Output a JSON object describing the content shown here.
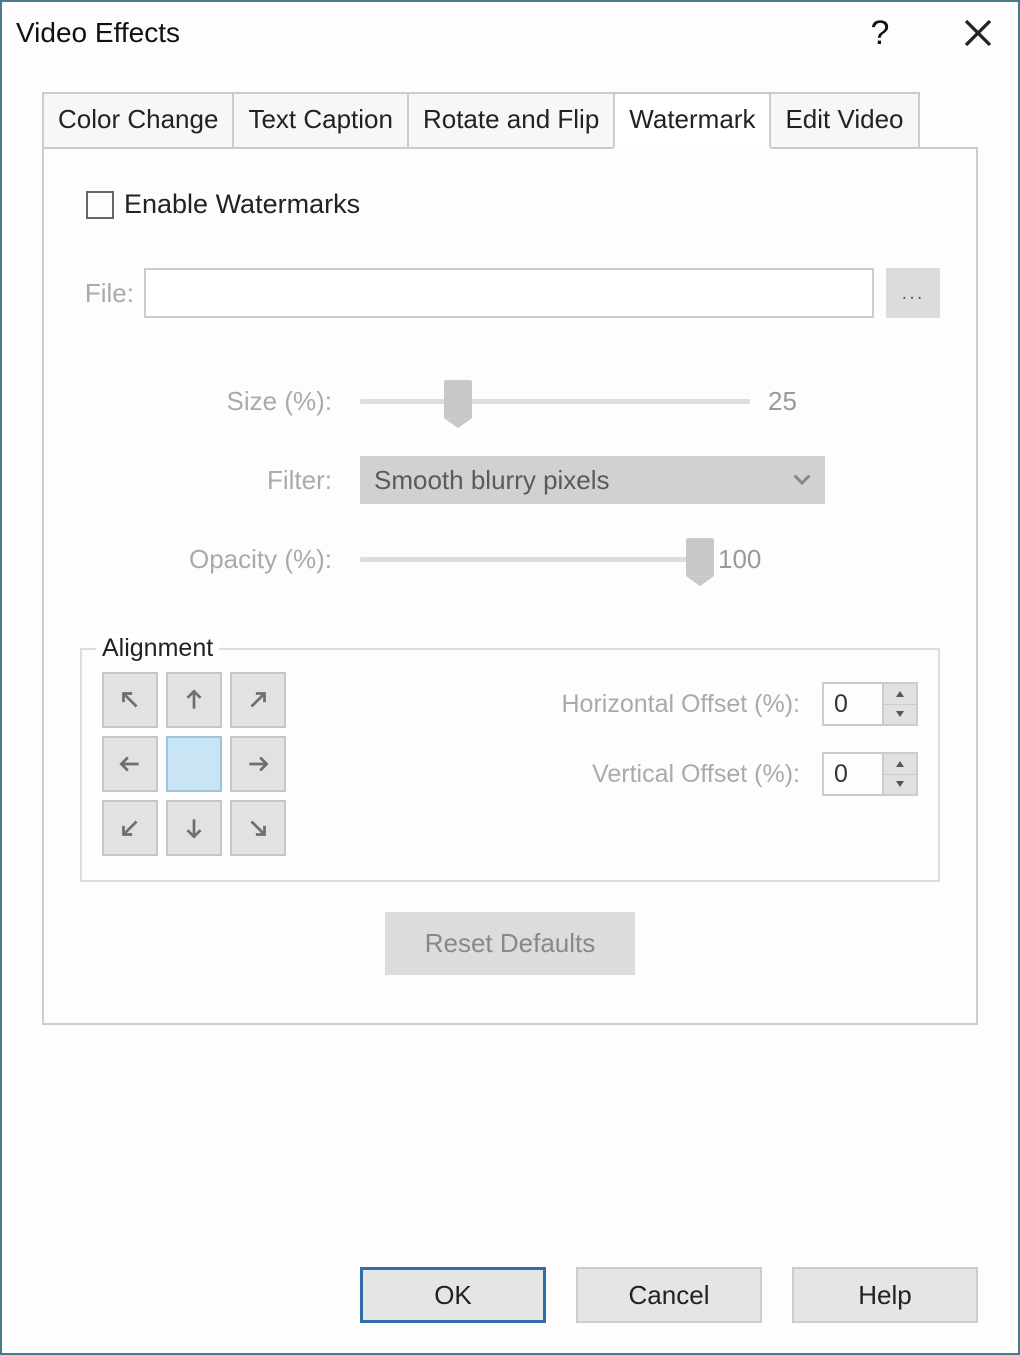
{
  "title": "Video Effects",
  "tabs": [
    {
      "label": "Color Change"
    },
    {
      "label": "Text Caption"
    },
    {
      "label": "Rotate and Flip"
    },
    {
      "label": "Watermark"
    },
    {
      "label": "Edit Video"
    }
  ],
  "enable_label": "Enable Watermarks",
  "file_label": "File:",
  "file_value": "",
  "browse_btn": "...",
  "size_label": "Size (%):",
  "size_value": "25",
  "filter_label": "Filter:",
  "filter_value": "Smooth blurry pixels",
  "opacity_label": "Opacity (%):",
  "opacity_value": "100",
  "alignment_legend": "Alignment",
  "h_offset_label": "Horizontal Offset (%):",
  "h_offset_value": "0",
  "v_offset_label": "Vertical Offset (%):",
  "v_offset_value": "0",
  "reset_label": "Reset Defaults",
  "buttons": {
    "ok": "OK",
    "cancel": "Cancel",
    "help": "Help"
  }
}
